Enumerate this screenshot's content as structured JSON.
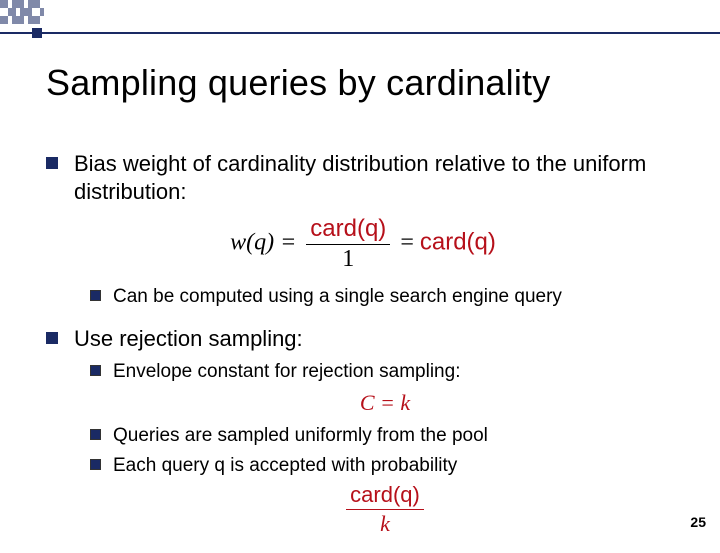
{
  "slide": {
    "title": "Sampling queries by cardinality",
    "page_number": "25"
  },
  "bullets": [
    {
      "text": "Bias weight of cardinality distribution relative to the uniform distribution:",
      "formula": {
        "lhs": "w(q) =",
        "frac_num": "card(q)",
        "frac_den": "1",
        "eq": " = ",
        "rhs": "card(q)"
      },
      "sub": [
        {
          "text": "Can be computed using a single search engine query"
        }
      ]
    },
    {
      "text": "Use rejection sampling:",
      "sub": [
        {
          "text": "Envelope constant for rejection sampling:",
          "formula2": "C = k"
        },
        {
          "text": "Queries are sampled uniformly from the pool"
        },
        {
          "text": "Each query q is accepted with probability",
          "formula3": {
            "num": "card(q)",
            "den": "k"
          }
        }
      ]
    }
  ]
}
